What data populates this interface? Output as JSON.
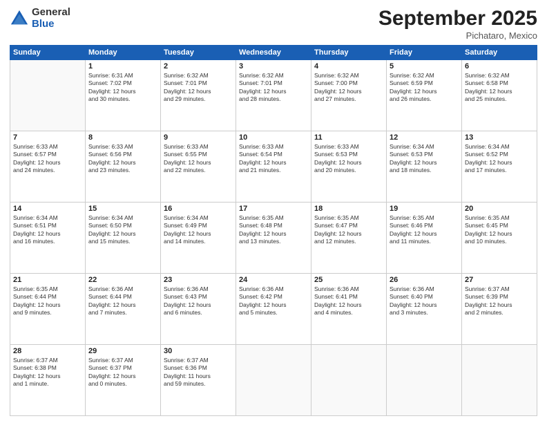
{
  "logo": {
    "general": "General",
    "blue": "Blue"
  },
  "header": {
    "month": "September 2025",
    "location": "Pichataro, Mexico"
  },
  "weekdays": [
    "Sunday",
    "Monday",
    "Tuesday",
    "Wednesday",
    "Thursday",
    "Friday",
    "Saturday"
  ],
  "weeks": [
    [
      {
        "day": "",
        "info": ""
      },
      {
        "day": "1",
        "info": "Sunrise: 6:31 AM\nSunset: 7:02 PM\nDaylight: 12 hours\nand 30 minutes."
      },
      {
        "day": "2",
        "info": "Sunrise: 6:32 AM\nSunset: 7:01 PM\nDaylight: 12 hours\nand 29 minutes."
      },
      {
        "day": "3",
        "info": "Sunrise: 6:32 AM\nSunset: 7:01 PM\nDaylight: 12 hours\nand 28 minutes."
      },
      {
        "day": "4",
        "info": "Sunrise: 6:32 AM\nSunset: 7:00 PM\nDaylight: 12 hours\nand 27 minutes."
      },
      {
        "day": "5",
        "info": "Sunrise: 6:32 AM\nSunset: 6:59 PM\nDaylight: 12 hours\nand 26 minutes."
      },
      {
        "day": "6",
        "info": "Sunrise: 6:32 AM\nSunset: 6:58 PM\nDaylight: 12 hours\nand 25 minutes."
      }
    ],
    [
      {
        "day": "7",
        "info": "Sunrise: 6:33 AM\nSunset: 6:57 PM\nDaylight: 12 hours\nand 24 minutes."
      },
      {
        "day": "8",
        "info": "Sunrise: 6:33 AM\nSunset: 6:56 PM\nDaylight: 12 hours\nand 23 minutes."
      },
      {
        "day": "9",
        "info": "Sunrise: 6:33 AM\nSunset: 6:55 PM\nDaylight: 12 hours\nand 22 minutes."
      },
      {
        "day": "10",
        "info": "Sunrise: 6:33 AM\nSunset: 6:54 PM\nDaylight: 12 hours\nand 21 minutes."
      },
      {
        "day": "11",
        "info": "Sunrise: 6:33 AM\nSunset: 6:53 PM\nDaylight: 12 hours\nand 20 minutes."
      },
      {
        "day": "12",
        "info": "Sunrise: 6:34 AM\nSunset: 6:53 PM\nDaylight: 12 hours\nand 18 minutes."
      },
      {
        "day": "13",
        "info": "Sunrise: 6:34 AM\nSunset: 6:52 PM\nDaylight: 12 hours\nand 17 minutes."
      }
    ],
    [
      {
        "day": "14",
        "info": "Sunrise: 6:34 AM\nSunset: 6:51 PM\nDaylight: 12 hours\nand 16 minutes."
      },
      {
        "day": "15",
        "info": "Sunrise: 6:34 AM\nSunset: 6:50 PM\nDaylight: 12 hours\nand 15 minutes."
      },
      {
        "day": "16",
        "info": "Sunrise: 6:34 AM\nSunset: 6:49 PM\nDaylight: 12 hours\nand 14 minutes."
      },
      {
        "day": "17",
        "info": "Sunrise: 6:35 AM\nSunset: 6:48 PM\nDaylight: 12 hours\nand 13 minutes."
      },
      {
        "day": "18",
        "info": "Sunrise: 6:35 AM\nSunset: 6:47 PM\nDaylight: 12 hours\nand 12 minutes."
      },
      {
        "day": "19",
        "info": "Sunrise: 6:35 AM\nSunset: 6:46 PM\nDaylight: 12 hours\nand 11 minutes."
      },
      {
        "day": "20",
        "info": "Sunrise: 6:35 AM\nSunset: 6:45 PM\nDaylight: 12 hours\nand 10 minutes."
      }
    ],
    [
      {
        "day": "21",
        "info": "Sunrise: 6:35 AM\nSunset: 6:44 PM\nDaylight: 12 hours\nand 9 minutes."
      },
      {
        "day": "22",
        "info": "Sunrise: 6:36 AM\nSunset: 6:44 PM\nDaylight: 12 hours\nand 7 minutes."
      },
      {
        "day": "23",
        "info": "Sunrise: 6:36 AM\nSunset: 6:43 PM\nDaylight: 12 hours\nand 6 minutes."
      },
      {
        "day": "24",
        "info": "Sunrise: 6:36 AM\nSunset: 6:42 PM\nDaylight: 12 hours\nand 5 minutes."
      },
      {
        "day": "25",
        "info": "Sunrise: 6:36 AM\nSunset: 6:41 PM\nDaylight: 12 hours\nand 4 minutes."
      },
      {
        "day": "26",
        "info": "Sunrise: 6:36 AM\nSunset: 6:40 PM\nDaylight: 12 hours\nand 3 minutes."
      },
      {
        "day": "27",
        "info": "Sunrise: 6:37 AM\nSunset: 6:39 PM\nDaylight: 12 hours\nand 2 minutes."
      }
    ],
    [
      {
        "day": "28",
        "info": "Sunrise: 6:37 AM\nSunset: 6:38 PM\nDaylight: 12 hours\nand 1 minute."
      },
      {
        "day": "29",
        "info": "Sunrise: 6:37 AM\nSunset: 6:37 PM\nDaylight: 12 hours\nand 0 minutes."
      },
      {
        "day": "30",
        "info": "Sunrise: 6:37 AM\nSunset: 6:36 PM\nDaylight: 11 hours\nand 59 minutes."
      },
      {
        "day": "",
        "info": ""
      },
      {
        "day": "",
        "info": ""
      },
      {
        "day": "",
        "info": ""
      },
      {
        "day": "",
        "info": ""
      }
    ]
  ]
}
